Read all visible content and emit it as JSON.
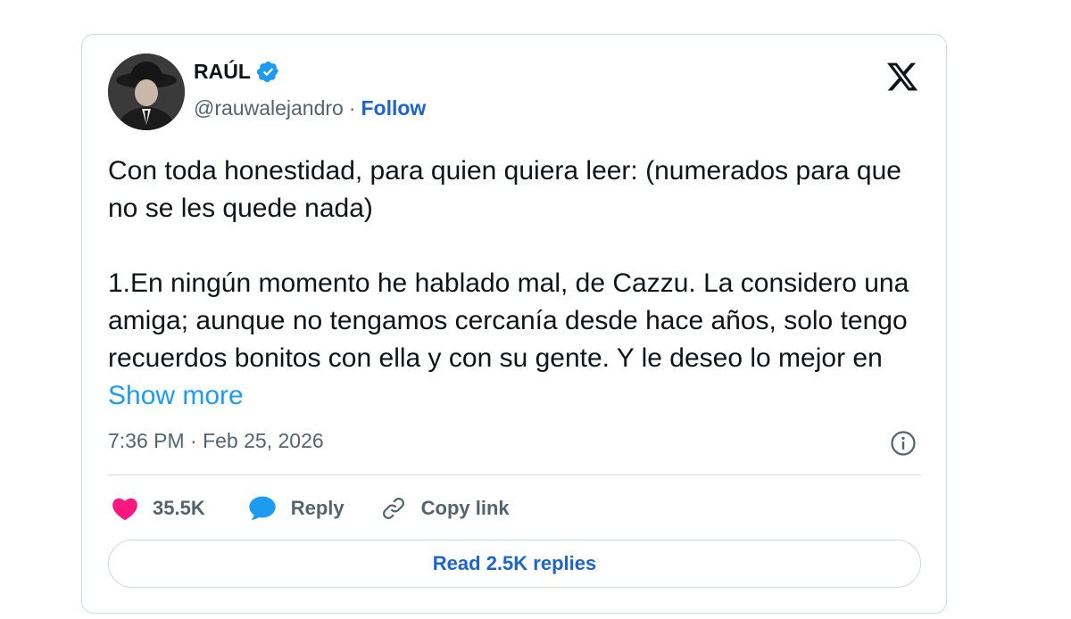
{
  "author": {
    "name": "RAÚL",
    "handle": "@rauwalejandro",
    "separator": "·",
    "follow_label": "Follow"
  },
  "tweet": {
    "text": "Con toda honestidad, para quien quiera leer: (numerados para que no se les quede nada)\n\n1.En ningún momento he hablado mal, de Cazzu. La considero una amiga; aunque no tengamos cercanía desde hace años, solo tengo recuerdos bonitos con ella y con su gente. Y le deseo lo mejor en ",
    "show_more_label": "Show more",
    "timestamp": "7:36 PM · Feb 25, 2026"
  },
  "actions": {
    "likes": "35.5K",
    "reply_label": "Reply",
    "copy_label": "Copy link"
  },
  "read_replies_label": "Read 2.5K replies",
  "icons": {
    "verified": "verified-badge-icon",
    "platform": "x-logo-icon",
    "info": "info-icon",
    "like": "heart-icon",
    "reply": "speech-bubble-icon",
    "copy": "link-icon"
  },
  "colors": {
    "accent": "#1d9bf0",
    "follow": "#1d65c9",
    "heart": "#f91880",
    "muted": "#536471",
    "border": "#cfd9de"
  }
}
